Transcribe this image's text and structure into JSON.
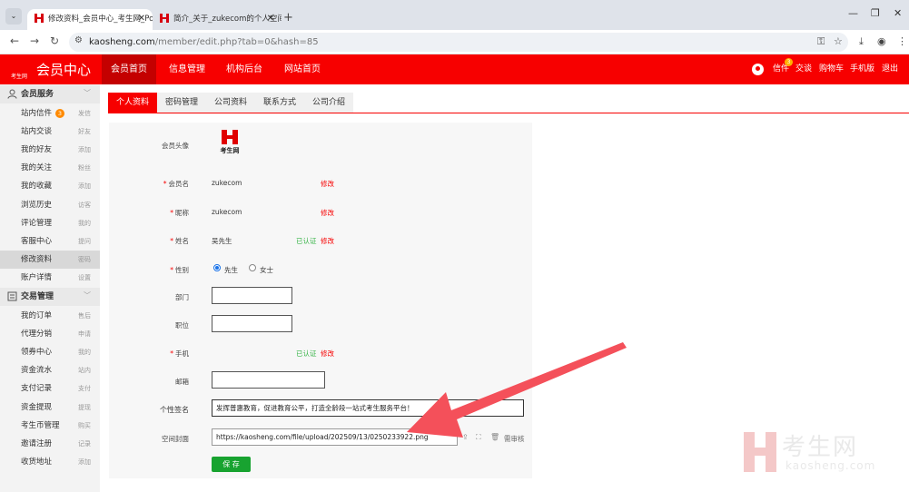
{
  "browser": {
    "tabs": [
      {
        "title": "修改资料_会员中心_考生网_Po"
      },
      {
        "title": "简介_关于_zukecom的个人空间"
      }
    ],
    "url_host": "kaosheng.com",
    "url_path": "/member/edit.php?tab=0&hash=85"
  },
  "header": {
    "logo_small": "考生网",
    "title": "会员中心",
    "nav": [
      "会员首页",
      "信息管理",
      "机构后台",
      "网站首页"
    ],
    "mail_label": "信件",
    "mail_count": "3",
    "links": [
      "交谈",
      "购物车",
      "手机版",
      "退出"
    ]
  },
  "sidebar": {
    "section1": "会员服务",
    "items1": [
      {
        "label": "站内信件",
        "sub": "发信",
        "badge": "3"
      },
      {
        "label": "站内交谈",
        "sub": "好友"
      },
      {
        "label": "我的好友",
        "sub": "添加"
      },
      {
        "label": "我的关注",
        "sub": "粉丝"
      },
      {
        "label": "我的收藏",
        "sub": "添加"
      },
      {
        "label": "浏览历史",
        "sub": "访客"
      },
      {
        "label": "评论管理",
        "sub": "我的"
      },
      {
        "label": "客服中心",
        "sub": "提问"
      },
      {
        "label": "修改资料",
        "sub": "密码"
      },
      {
        "label": "账户详情",
        "sub": "设置"
      }
    ],
    "section2": "交易管理",
    "items2": [
      {
        "label": "我的订单",
        "sub": "售后"
      },
      {
        "label": "代理分销",
        "sub": "申请"
      },
      {
        "label": "领券中心",
        "sub": "我的"
      },
      {
        "label": "资金流水",
        "sub": "站内"
      },
      {
        "label": "支付记录",
        "sub": "支付"
      },
      {
        "label": "资金提现",
        "sub": "提现"
      },
      {
        "label": "考生币管理",
        "sub": "购买"
      },
      {
        "label": "邀请注册",
        "sub": "记录"
      },
      {
        "label": "收货地址",
        "sub": "添加"
      }
    ]
  },
  "content_tabs": [
    "个人资料",
    "密码管理",
    "公司资料",
    "联系方式",
    "公司介绍"
  ],
  "form": {
    "avatar_label": "会员头像",
    "avatar_caption": "考生网",
    "username_label": "会员名",
    "username_value": "zukecom",
    "nickname_label": "昵称",
    "nickname_value": "zukecom",
    "realname_label": "姓名",
    "realname_value": "吴先生",
    "gender_label": "性别",
    "gender_male": "先生",
    "gender_female": "女士",
    "dept_label": "部门",
    "position_label": "职位",
    "phone_label": "手机",
    "email_label": "邮箱",
    "signature_label": "个性签名",
    "signature_value": "发挥普惠教育，促进教育公平，打造全龄段一站式考生服务平台！",
    "cover_label": "空间封面",
    "cover_value": "https://kaosheng.com/file/upload/202509/13/0250233922.png",
    "cover_status": "需审核",
    "verified": "已认证",
    "edit": "修改",
    "save": "保 存"
  },
  "watermark": {
    "cn": "考生网",
    "en": "kaosheng.com"
  },
  "colors": {
    "brand": "#f70000",
    "save": "#18a330",
    "arrow": "#f4505a"
  }
}
